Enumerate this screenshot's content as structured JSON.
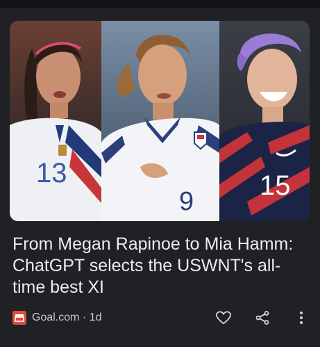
{
  "article": {
    "title": "From Megan Rapinoe to Mia Hamm: ChatGPT selects the USWNT's all-time best XI",
    "source": "Goal.com",
    "separator": "·",
    "age": "1d"
  },
  "image": {
    "jersey_numbers": [
      "13",
      "9",
      "15"
    ]
  },
  "icons": {
    "source": "goal-logo-icon",
    "like": "heart-outline-icon",
    "share": "share-icon",
    "more": "more-vert-icon"
  },
  "colors": {
    "background": "#202124",
    "text": "#ececef",
    "source_text": "#c9c9cc",
    "source_logo": "#e04a3b"
  }
}
